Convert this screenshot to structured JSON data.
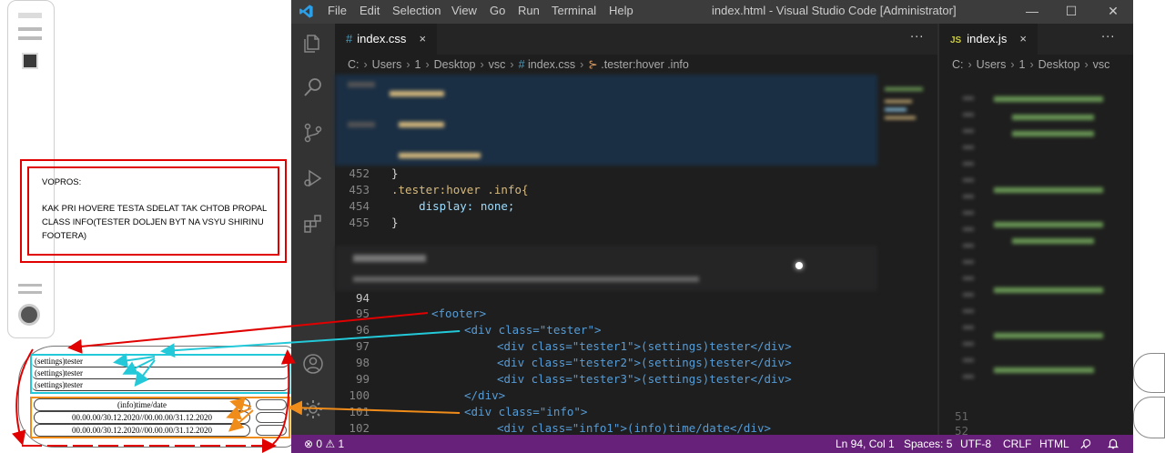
{
  "preview": {
    "question_title": "VOPROS:",
    "question_body": "KAK PRI HOVERE TESTA SDELAT TAK CHTOB PROPAL CLASS INFO(TESTER DOLJEN BYT NA VSYU SHIRINU FOOTERA)",
    "tester_rows": [
      "(settings)tester",
      "(settings)tester",
      "(settings)tester"
    ],
    "info_rows": [
      "(info)time/date",
      "00.00.00/30.12.2020//00.00.00/31.12.2020",
      "00.00.00/30.12.2020//00.00.00/31.12.2020"
    ]
  },
  "titlebar": {
    "menu": [
      "File",
      "Edit",
      "Selection",
      "View",
      "Go",
      "Run",
      "Terminal",
      "Help"
    ],
    "title": "index.html - Visual Studio Code [Administrator]",
    "minimize": "—",
    "maximize": "☐",
    "close": "✕"
  },
  "editor_left": {
    "tab_label": "index.css",
    "tab_close": "×",
    "more": "···",
    "breadcrumb": [
      "C:",
      "Users",
      "1",
      "Desktop",
      "vsc",
      "index.css",
      ".tester:hover .info"
    ],
    "css_lines": [
      {
        "n": "452",
        "text": "}"
      },
      {
        "n": "453",
        "text": ".tester:hover .info{"
      },
      {
        "n": "454",
        "text": "    display: none;"
      },
      {
        "n": "455",
        "text": "}"
      }
    ],
    "html_lines": [
      {
        "n": "94",
        "text": ""
      },
      {
        "n": "95",
        "text": "<footer>"
      },
      {
        "n": "96",
        "text": "<div class=\"tester\">"
      },
      {
        "n": "97",
        "text": "<div class=\"tester1\">(settings)tester</div>"
      },
      {
        "n": "98",
        "text": "<div class=\"tester2\">(settings)tester</div>"
      },
      {
        "n": "99",
        "text": "<div class=\"tester3\">(settings)tester</div>"
      },
      {
        "n": "100",
        "text": "</div>"
      },
      {
        "n": "101",
        "text": "<div class=\"info\">"
      },
      {
        "n": "102",
        "text": "<div class=\"info1\">(info)time/date</div>"
      }
    ]
  },
  "editor_right": {
    "tab_label": "index.js",
    "tab_icon": "JS",
    "tab_close": "×",
    "more": "···",
    "breadcrumb": [
      "C:",
      "Users",
      "1",
      "Desktop",
      "vsc"
    ],
    "visible_line_numbers": [
      "51",
      "52"
    ]
  },
  "statusbar": {
    "problems": "⊗ 0 ⚠ 1",
    "position": "Ln 94, Col 1",
    "spaces": "Spaces: 5",
    "encoding": "UTF-8",
    "eol": "CRLF",
    "language": "HTML"
  },
  "colors": {
    "titlebar": "#3c3c3c",
    "activitybar": "#333333",
    "editor_bg": "#1e1e1e",
    "statusbar": "#68217a",
    "annot_red": "#e00000",
    "annot_cyan": "#23c9d8",
    "annot_orange": "#f08c1a"
  }
}
